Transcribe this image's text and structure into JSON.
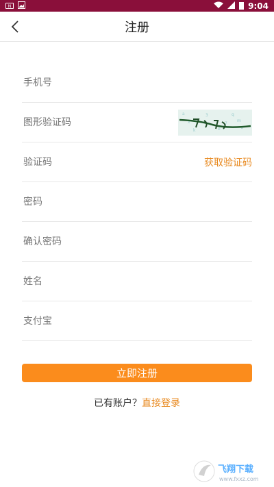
{
  "status_bar": {
    "time": "9:04",
    "icons": [
      "notification-icon",
      "image-icon",
      "wifi-icon",
      "signal-icon",
      "battery-icon"
    ]
  },
  "header": {
    "title": "注册",
    "back_icon": "chevron-left-icon"
  },
  "form": {
    "phone_placeholder": "手机号",
    "captcha_placeholder": "图形验证码",
    "sms_code_placeholder": "验证码",
    "get_code_label": "获取验证码",
    "password_placeholder": "密码",
    "confirm_password_placeholder": "确认密码",
    "name_placeholder": "姓名",
    "alipay_placeholder": "支付宝"
  },
  "submit_label": "立即注册",
  "login_prompt": {
    "text": "已有账户？",
    "link": "直接登录"
  },
  "watermark": {
    "text": "飞翔下载",
    "url": "www.fxxz.com"
  },
  "colors": {
    "status_bar": "#8a0f3a",
    "accent": "#fb8c1c",
    "link": "#e8891f"
  }
}
